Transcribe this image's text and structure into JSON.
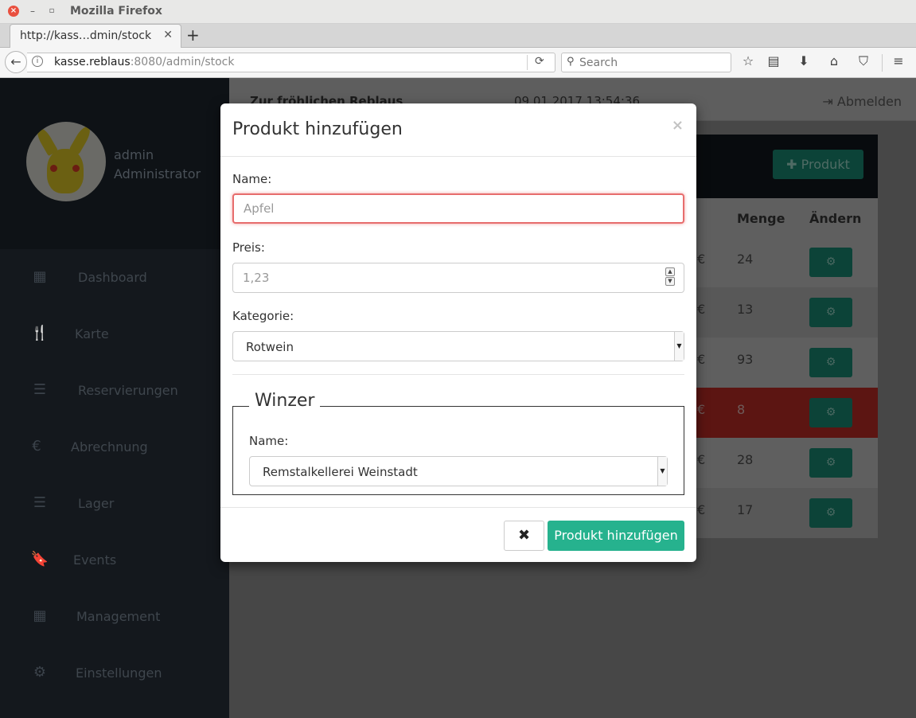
{
  "window": {
    "title": "Mozilla Firefox"
  },
  "tab": {
    "title": "http://kass…dmin/stock"
  },
  "address": {
    "host": "kasse.reblaus",
    "rest": ":8080/admin/stock"
  },
  "search": {
    "placeholder": "Search"
  },
  "toolbar_icons": [
    "bookmark-star-icon",
    "reader-list-icon",
    "download-icon",
    "home-icon",
    "pocket-icon",
    "hamburger-menu-icon"
  ],
  "profile": {
    "name": "admin",
    "role": "Administrator"
  },
  "sidebar": {
    "items": [
      {
        "label": "Dashboard",
        "icon": "grid-icon"
      },
      {
        "label": "Karte",
        "icon": "cutlery-icon"
      },
      {
        "label": "Reservierungen",
        "icon": "list-icon"
      },
      {
        "label": "Abrechnung",
        "icon": "euro-icon"
      },
      {
        "label": "Lager",
        "icon": "list-icon"
      },
      {
        "label": "Events",
        "icon": "bookmark-icon"
      },
      {
        "label": "Management",
        "icon": "calendar-icon"
      },
      {
        "label": "Einstellungen",
        "icon": "gear-icon"
      }
    ]
  },
  "header": {
    "shop": "Zur fröhlichen Reblaus",
    "datetime": "09.01.2017 13:54:36",
    "logout": "Abmelden"
  },
  "panel": {
    "add_button": "Produkt",
    "columns": {
      "menge": "Menge",
      "aendern": "Ändern"
    },
    "rows": [
      {
        "euro": "€",
        "menge": "24",
        "state": "normal"
      },
      {
        "euro": "€",
        "menge": "13",
        "state": "alt"
      },
      {
        "euro": "€",
        "menge": "93",
        "state": "normal"
      },
      {
        "euro": "€",
        "menge": "8",
        "state": "danger"
      },
      {
        "euro": "€",
        "menge": "28",
        "state": "normal"
      },
      {
        "euro": "€",
        "menge": "17",
        "state": "alt"
      }
    ]
  },
  "modal": {
    "title": "Produkt hinzufügen",
    "close": "×",
    "name_label": "Name:",
    "name_placeholder": "Apfel",
    "price_label": "Preis:",
    "price_placeholder": "1,23",
    "category_label": "Kategorie:",
    "category_value": "Rotwein",
    "winzer_legend": "Winzer",
    "winzer_name_label": "Name:",
    "winzer_value": "Remstalkellerei Weinstadt",
    "cancel": "✖",
    "submit": "Produkt hinzufügen"
  },
  "colors": {
    "accent": "#26b28e",
    "error_border": "#e76d6d",
    "danger_row": "#c0392b"
  }
}
